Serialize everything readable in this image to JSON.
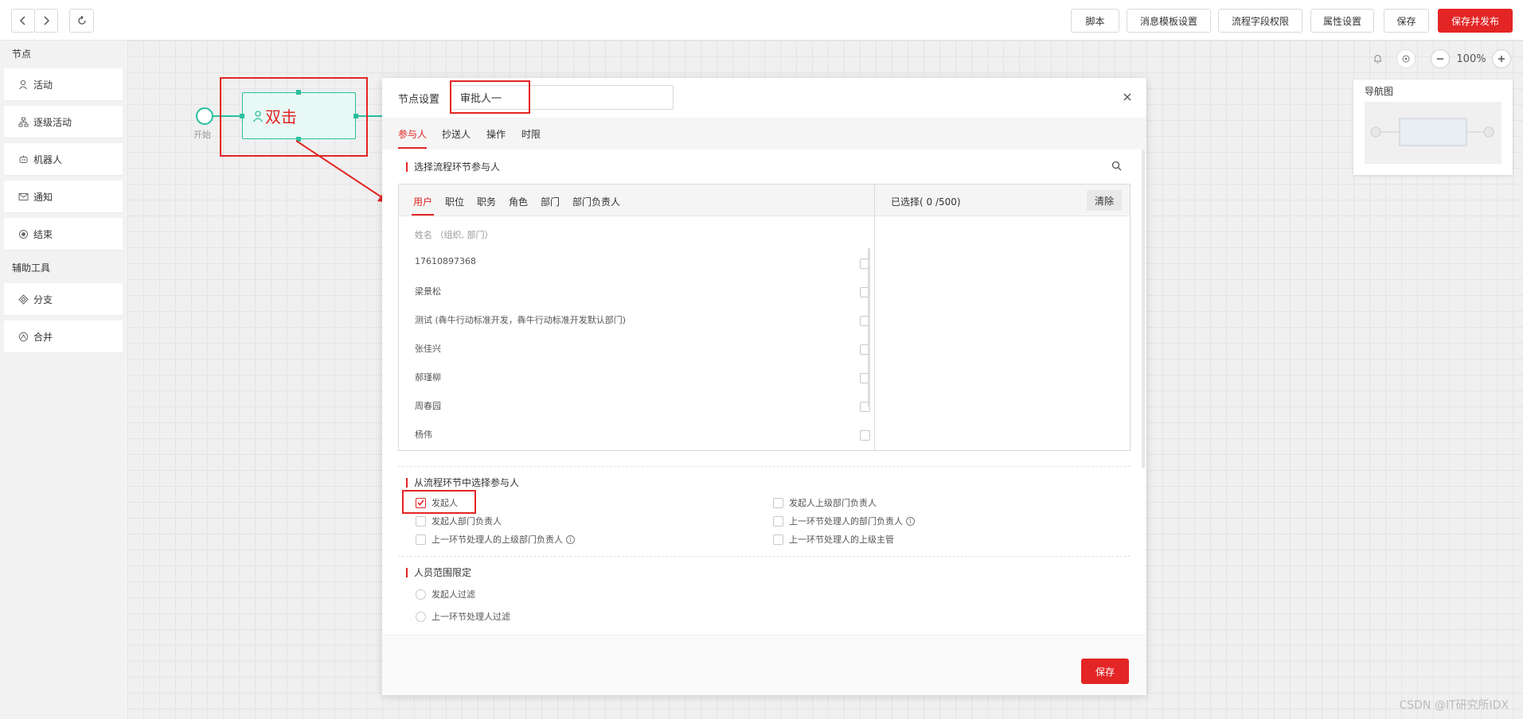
{
  "toolbar": {
    "back_icon": "chevron-left-icon",
    "forward_icon": "chevron-right-icon",
    "refresh_icon": "refresh-icon",
    "buttons": [
      "脚本",
      "消息模板设置",
      "流程字段权限",
      "属性设置",
      "保存"
    ],
    "publish_label": "保存并发布",
    "accent_color": "#e32525"
  },
  "leftpanel": {
    "section_nodes": "节点",
    "nodes": [
      {
        "label": "活动",
        "icon": "user-icon"
      },
      {
        "label": "逐级活动",
        "icon": "hierarchy-icon"
      },
      {
        "label": "机器人",
        "icon": "robot-icon"
      },
      {
        "label": "通知",
        "icon": "mail-icon"
      },
      {
        "label": "结束",
        "icon": "end-circle-icon"
      }
    ],
    "section_tools": "辅助工具",
    "tools": [
      {
        "label": "分支",
        "icon": "diamond-icon"
      },
      {
        "label": "合并",
        "icon": "merge-icon"
      }
    ]
  },
  "canvas": {
    "start_label": "开始",
    "node_label": "双击",
    "zoom_level": "100%",
    "navmap_title": "导航图",
    "flow_color": "#2bbf9e"
  },
  "modal": {
    "title": "节点设置",
    "node_name": "审批人一",
    "tabs": [
      "参与人",
      "抄送人",
      "操作",
      "时限"
    ],
    "active_tab": "参与人",
    "section_select": "选择流程环节参与人",
    "picker_tabs": [
      "用户",
      "职位",
      "职务",
      "角色",
      "部门",
      "部门负责人"
    ],
    "selected_count": "已选择( 0 /500)",
    "clear_label": "清除",
    "name_hint": "姓名 （组织, 部门）",
    "users": [
      "17610897368",
      "梁景松",
      "测试 (犇牛行动标准开发，犇牛行动标准开发默认部门)",
      "张佳兴",
      "郝瑾柳",
      "周春园",
      "杨伟"
    ],
    "section_from_flow": "从流程环节中选择参与人",
    "flow_options_left": [
      {
        "label": "发起人",
        "checked": true,
        "info": false
      },
      {
        "label": "发起人部门负责人",
        "checked": false,
        "info": false
      },
      {
        "label": "上一环节处理人的上级部门负责人",
        "checked": false,
        "info": true
      }
    ],
    "flow_options_right": [
      {
        "label": "发起人上级部门负责人",
        "checked": false,
        "info": false
      },
      {
        "label": "上一环节处理人的部门负责人",
        "checked": false,
        "info": true
      },
      {
        "label": "上一环节处理人的上级主管",
        "checked": false,
        "info": false
      }
    ],
    "section_scope": "人员范围限定",
    "scope_options": [
      "发起人过滤",
      "上一环节处理人过滤"
    ],
    "save_label": "保存"
  },
  "watermark": "CSDN @IT研究所IDX"
}
